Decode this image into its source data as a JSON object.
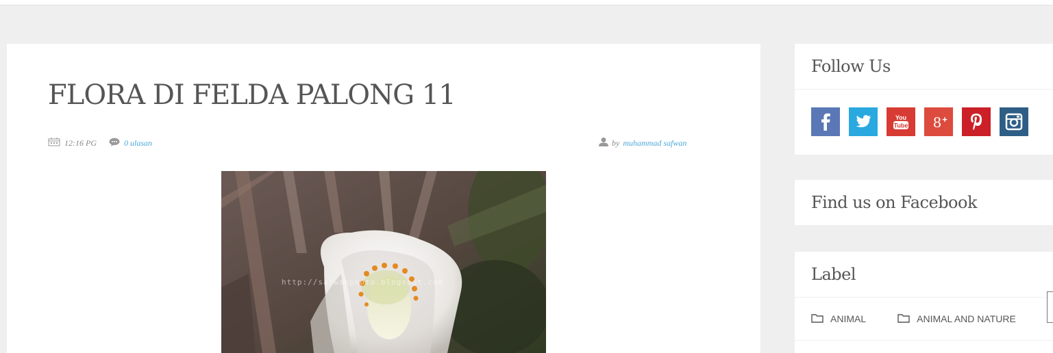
{
  "post": {
    "title": "FLORA DI FELDA PALONG 11",
    "time": "12:16 PG",
    "comments": "0 ulasan",
    "author_prefix": "by",
    "author": "muhammad safwan",
    "image_watermark": "http://safwanphoto.blogspot.com"
  },
  "sidebar": {
    "follow_title": "Follow Us",
    "social_icons": [
      "facebook-icon",
      "twitter-icon",
      "youtube-icon",
      "google-plus-icon",
      "pinterest-icon",
      "instagram-icon"
    ],
    "social_colors": {
      "facebook": "#5a78b5",
      "twitter": "#29a9df",
      "youtube": "#d73b33",
      "google_plus": "#dc4b3e",
      "pinterest": "#cb2027",
      "instagram": "#2e5e86"
    },
    "facebook_title": "Find us on Facebook",
    "label_title": "Label",
    "labels": [
      "ANIMAL",
      "ANIMAL AND NATURE"
    ]
  },
  "colors": {
    "background": "#efefef",
    "link": "#4aa8d8",
    "heading": "#555555"
  }
}
